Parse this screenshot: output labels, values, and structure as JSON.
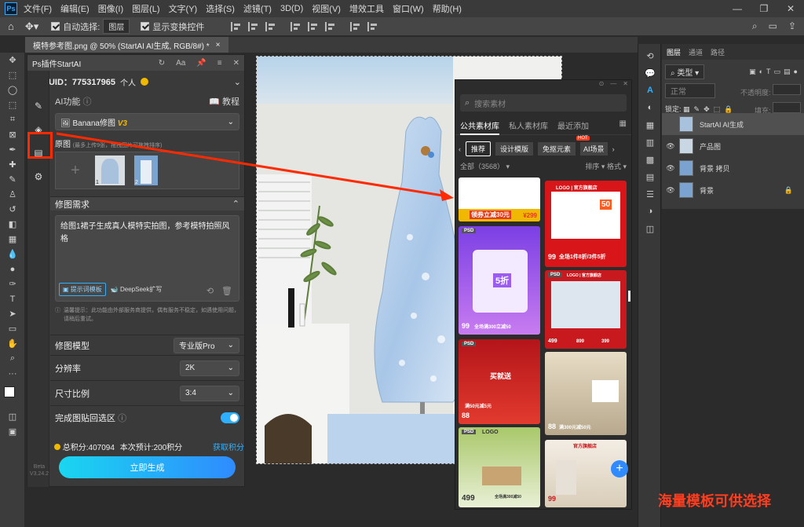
{
  "menubar": {
    "items": [
      "文件(F)",
      "编辑(E)",
      "图像(I)",
      "图层(L)",
      "文字(Y)",
      "选择(S)",
      "滤镜(T)",
      "3D(D)",
      "视图(V)",
      "增效工具",
      "窗口(W)",
      "帮助(H)"
    ]
  },
  "options": {
    "auto_select_label": "自动选择:",
    "auto_select_value": "图层",
    "show_transform_label": "显示变换控件"
  },
  "document": {
    "tab_title": "模特参考图.png @ 50% (StartAI AI生成, RGB/8#) *"
  },
  "plugin": {
    "title": "Ps插件StartAI",
    "aa": "Aa",
    "uid": "UID：775317965",
    "account_type": "个人",
    "ai_function_label": "AI功能",
    "tutorial": "教程",
    "function_name": "Banana修图",
    "function_version": "V3",
    "original_label": "原图",
    "original_hint": "(最多上传9张，拖拽图片可拖拽排序)",
    "thumb1_index": "1",
    "thumb2_index": "2",
    "requirement_label": "修图需求",
    "prompt_text": "给图1裙子生成真人模特实拍图，参考模特拍照风格",
    "prompt_template_btn": "提示词模板",
    "deepseek_btn": "DeepSeek扩写",
    "notice": "温馨提示：此功能由外部服务商提供，偶有服务不稳定，如遇使用问题，请稍后重试。",
    "model_label": "修图模型",
    "model_value": "专业版Pro",
    "resolution_label": "分辨率",
    "resolution_value": "2K",
    "ratio_label": "尺寸比例",
    "ratio_value": "3:4",
    "paste_back_label": "完成图贴回选区",
    "paste_back_enabled": true,
    "points_total": "总积分:407094",
    "points_estimate": "本次预计:200积分",
    "get_points": "获取积分",
    "generate_btn": "立即生成",
    "beta": "Beta",
    "version": "V3.24.2"
  },
  "library": {
    "search_placeholder": "搜索素材",
    "tabs": [
      "公共素材库",
      "私人素材库",
      "最近添加"
    ],
    "chips": [
      "推荐",
      "设计模版",
      "免抠元素",
      "AI场景"
    ],
    "hot_badge": "HOT",
    "count_label": "全部（3568）",
    "sort_label": "排序",
    "format_label": "格式",
    "thumbs": [
      {
        "tag": "",
        "lines": [
          "领券立减30元",
          "¥299"
        ]
      },
      {
        "tag": "",
        "lines": [
          "LOGO | 官方旗舰店",
          "50",
          "全场1件8折/3件5折",
          "99"
        ]
      },
      {
        "tag": "PSD",
        "lines": [
          "5折",
          "全场满300立减50",
          "99"
        ]
      },
      {
        "tag": "PSD",
        "lines": [
          "LOGO | 官方旗舰店",
          "499",
          "899",
          "399"
        ]
      },
      {
        "tag": "PSD",
        "lines": [
          "买就送",
          "满50元减5元",
          "88"
        ]
      },
      {
        "tag": "",
        "lines": [
          "满300元减50元",
          "88"
        ]
      },
      {
        "tag": "PSD",
        "lines": [
          "LOGO",
          "全场满300减50",
          "499"
        ]
      },
      {
        "tag": "",
        "lines": [
          "官方旗舰店",
          "99"
        ]
      }
    ]
  },
  "layers": {
    "tabs": [
      "图层",
      "通道",
      "路径"
    ],
    "kind_label": "类型",
    "blend_mode": "正常",
    "opacity_label": "不透明度:",
    "lock_label": "锁定:",
    "fill_label": "填充:",
    "items": [
      "StartAI AI生成",
      "产品图",
      "背景 拷贝",
      "背景"
    ]
  },
  "caption": "海量模板可供选择",
  "colors": {
    "accent": "#2fb0ff",
    "highlight_red": "#ff2a00",
    "caption_red": "#ff3d1f",
    "gold": "#f0b800"
  }
}
